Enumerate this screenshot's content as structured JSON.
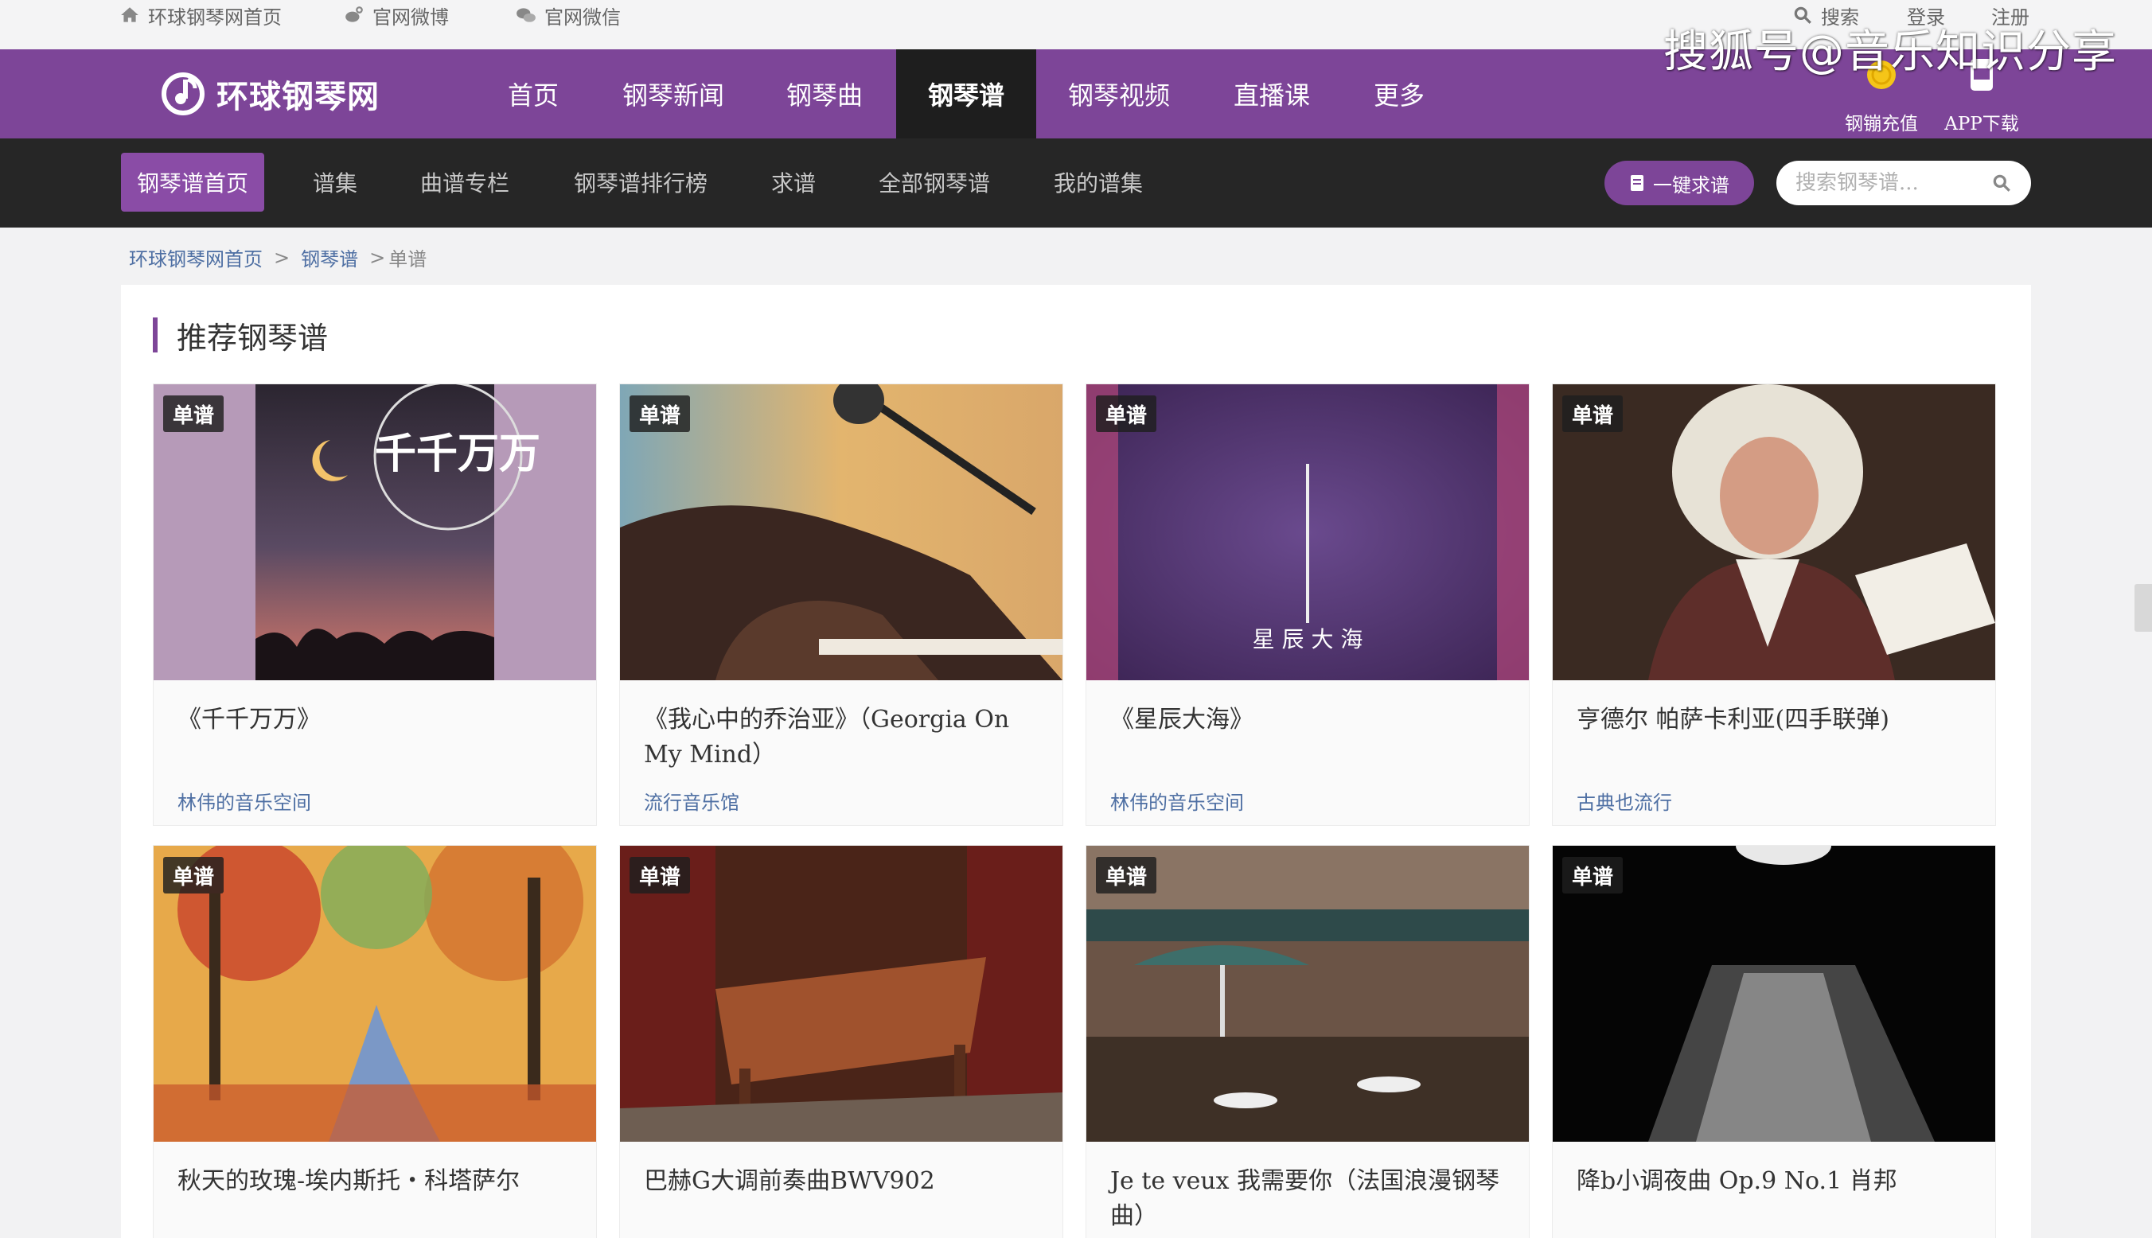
{
  "topbar": {
    "home_link": "环球钢琴网首页",
    "weibo_link": "官网微博",
    "wechat_link": "官网微信",
    "search": "搜索",
    "login": "登录",
    "register": "注册"
  },
  "watermark": "搜狐号@音乐知识分享",
  "mainnav": {
    "logo_text": "环球钢琴网",
    "items": [
      "首页",
      "钢琴新闻",
      "钢琴曲",
      "钢琴谱",
      "钢琴视频",
      "直播课",
      "更多"
    ],
    "active": "钢琴谱",
    "recharge": "钢镚充值",
    "app_download": "APP下载"
  },
  "subnav": {
    "items": [
      "钢琴谱首页",
      "谱集",
      "曲谱专栏",
      "钢琴谱排行榜",
      "求谱",
      "全部钢琴谱",
      "我的谱集"
    ],
    "active": "钢琴谱首页",
    "request_button": "一键求谱",
    "search_placeholder": "搜索钢琴谱..."
  },
  "breadcrumb": {
    "home": "环球钢琴网首页",
    "section": "钢琴谱",
    "current": "单谱",
    "separator": ">"
  },
  "section_title": "推荐钢琴谱",
  "cards": [
    {
      "tag": "单谱",
      "title": "《千千万万》",
      "source": "林伟的音乐空间",
      "thumb_text": "千千万万"
    },
    {
      "tag": "单谱",
      "title": "《我心中的乔治亚》（Georgia On My Mind）",
      "source": "流行音乐馆"
    },
    {
      "tag": "单谱",
      "title": "《星辰大海》",
      "source": "林伟的音乐空间",
      "thumb_text": "星 辰 大 海"
    },
    {
      "tag": "单谱",
      "title": "亨德尔 帕萨卡利亚(四手联弹)",
      "source": "古典也流行"
    },
    {
      "tag": "单谱",
      "title": "秋天的玫瑰-埃内斯托・科塔萨尔",
      "source": ""
    },
    {
      "tag": "单谱",
      "title": "巴赫G大调前奏曲BWV902",
      "source": ""
    },
    {
      "tag": "单谱",
      "title": "Je te veux 我需要你（法国浪漫钢琴曲）",
      "source": ""
    },
    {
      "tag": "单谱",
      "title": "降b小调夜曲 Op.9 No.1 肖邦",
      "source": ""
    }
  ],
  "icons": {
    "home": "home-icon",
    "weibo": "weibo-icon",
    "wechat": "wechat-icon",
    "search": "search-icon",
    "coin": "coin-icon",
    "app": "app-icon",
    "document": "document-icon"
  },
  "colors": {
    "brand_purple": "#7d4598",
    "subnav_bg": "#262626",
    "link_blue": "#4e6fa3",
    "coin_yellow": "#f5c518"
  }
}
